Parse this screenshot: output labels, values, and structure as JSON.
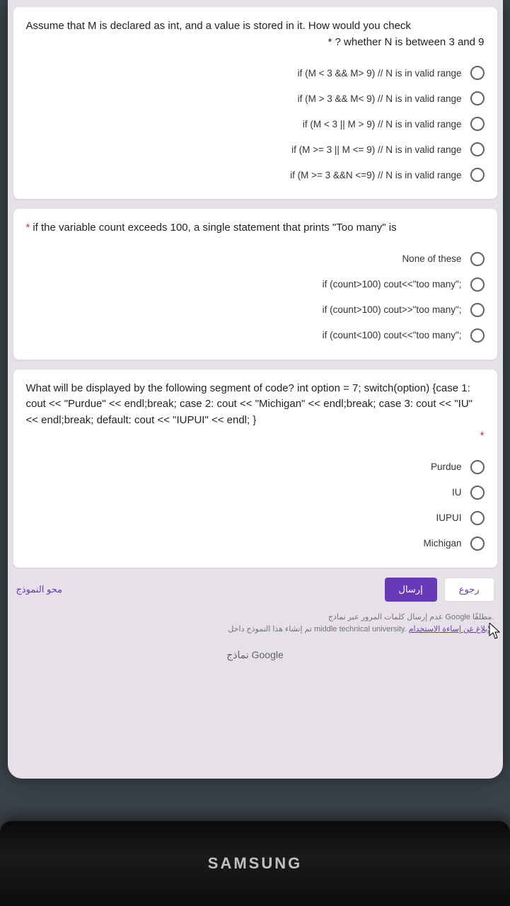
{
  "q1": {
    "title_line1": "Assume that M is declared as int, and a value is stored in it. How would you check",
    "title_line2": "* ? whether N is between 3 and 9",
    "options": [
      "if (M < 3 && M> 9) // N is in valid range",
      "if (M > 3 && M< 9) // N is in valid range",
      "if (M < 3 || M > 9) // N is in valid range",
      "if (M >= 3 || M <= 9) // N is in valid range",
      "if (M >= 3 &&N <=9) // N is in valid range"
    ]
  },
  "q2": {
    "required": "*",
    "title": "if the variable count exceeds 100, a single statement that prints \"Too many\" is",
    "options": [
      "None of these",
      "if (count>100) cout<<\"too many\";",
      "if (count>100) cout>>\"too many\";",
      "if (count<100) cout<<\"too many\";"
    ]
  },
  "q3": {
    "title": "What will be displayed by the following segment of code? int option = 7; switch(option) {case 1: cout << \"Purdue\" << endl;break; case 2: cout << \"Michigan\" << endl;break; case 3: cout << \"IU\" << endl;break; default: cout << \"IUPUI\" << endl; }",
    "required": "*",
    "options": [
      "Purdue",
      "IU",
      "IUPUI",
      "Michigan"
    ]
  },
  "footer": {
    "clear": "محو النموذج",
    "submit": "إرسال",
    "back": "رجوع",
    "disclaimer_line1": "عدم إرسال كلمات المرور عبر نماذج Google مطلقًا.",
    "disclaimer_line2_pre": "تم إنشاء هذا النموذج داخل middle technical university. ",
    "disclaimer_link": "الإبلاغ عن إساءة الاستخدام",
    "google_prefix": "نماذج ",
    "google": "Google"
  },
  "monitor": {
    "brand": "SAMSUNG"
  }
}
